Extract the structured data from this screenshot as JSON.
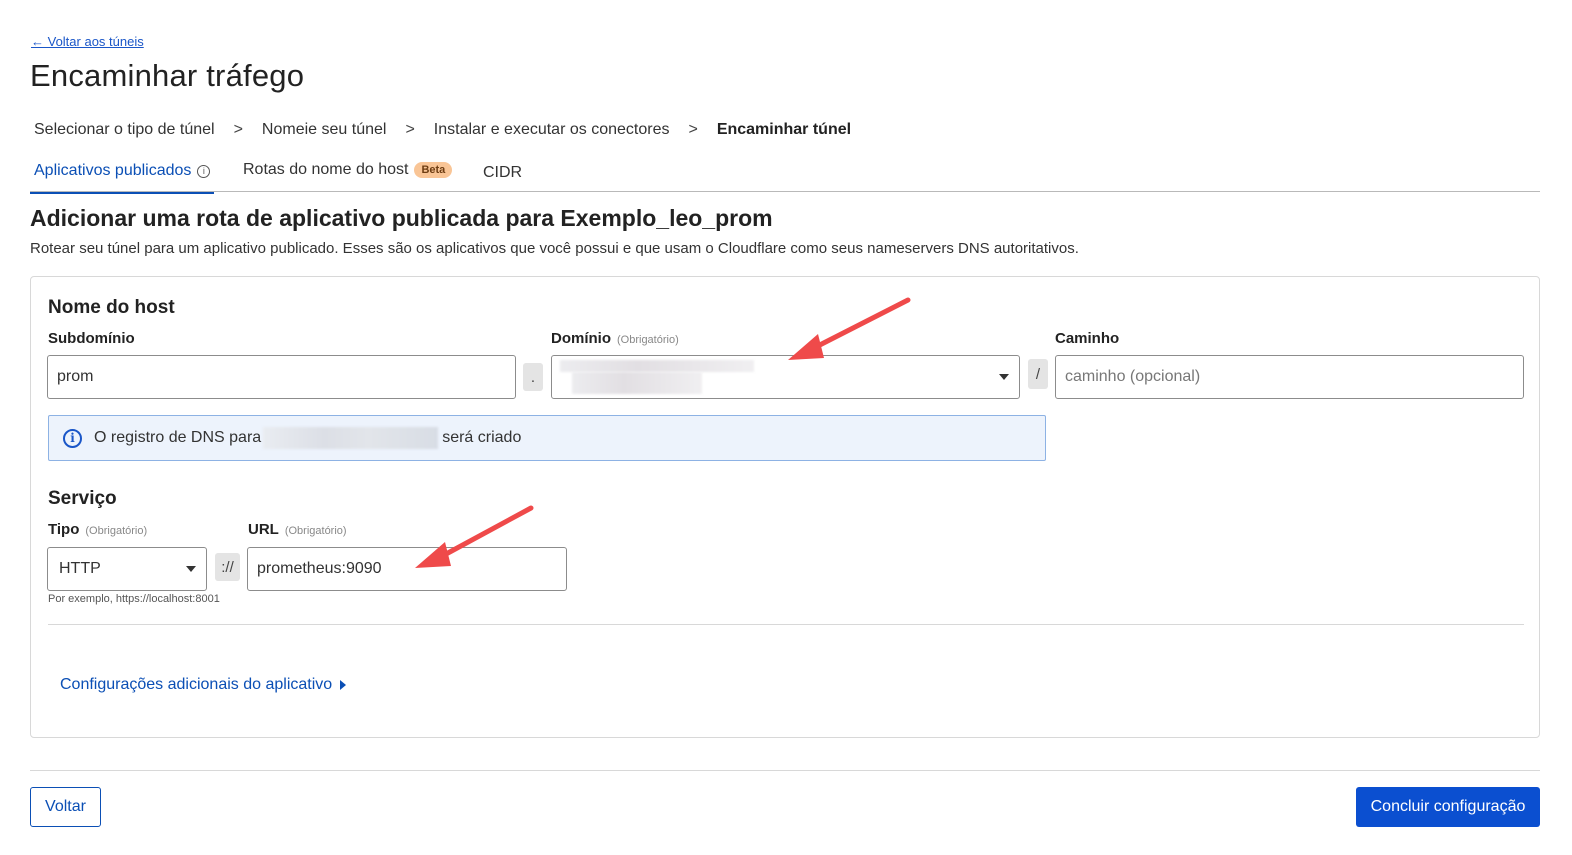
{
  "nav": {
    "back_link": "← Voltar aos túneis"
  },
  "page_title": "Encaminhar tráfego",
  "breadcrumb": {
    "steps": [
      "Selecionar o tipo de túnel",
      "Nomeie seu túnel",
      "Instalar e executar os conectores",
      "Encaminhar túnel"
    ],
    "separator": ">"
  },
  "tabs": [
    {
      "label": "Aplicativos publicados",
      "active": true
    },
    {
      "label": "Rotas do nome do host",
      "badge": "Beta"
    },
    {
      "label": "CIDR"
    }
  ],
  "section": {
    "title": "Adicionar uma rota de aplicativo publicada para Exemplo_leo_prom",
    "description": "Rotear seu túnel para um aplicativo publicado. Esses são os aplicativos que você possui e que usam o Cloudflare como seus nameservers DNS autoritativos."
  },
  "hostname": {
    "heading": "Nome do host",
    "subdomain_label": "Subdomínio",
    "subdomain_value": "prom",
    "dot_separator": ".",
    "domain_label": "Domínio",
    "domain_required": "(Obrigatório)",
    "slash_separator": "/",
    "path_label": "Caminho",
    "path_placeholder": "caminho (opcional)"
  },
  "notice": {
    "prefix": "O registro de DNS para",
    "suffix": "será criado"
  },
  "service": {
    "heading": "Serviço",
    "type_label": "Tipo",
    "type_required": "(Obrigatório)",
    "type_value": "HTTP",
    "scheme_separator": "://",
    "url_label": "URL",
    "url_required": "(Obrigatório)",
    "url_value": "prometheus:9090",
    "hint": "Por exemplo, https://localhost:8001"
  },
  "additional_settings": "Configurações adicionais do aplicativo",
  "footer": {
    "back_button": "Voltar",
    "finish_button": "Concluir configuração"
  },
  "colors": {
    "accent": "#0b4fb5",
    "primary_button": "#0b4fd0",
    "annotation_arrow": "#ef4a4a",
    "notice_bg": "#edf3fc"
  }
}
